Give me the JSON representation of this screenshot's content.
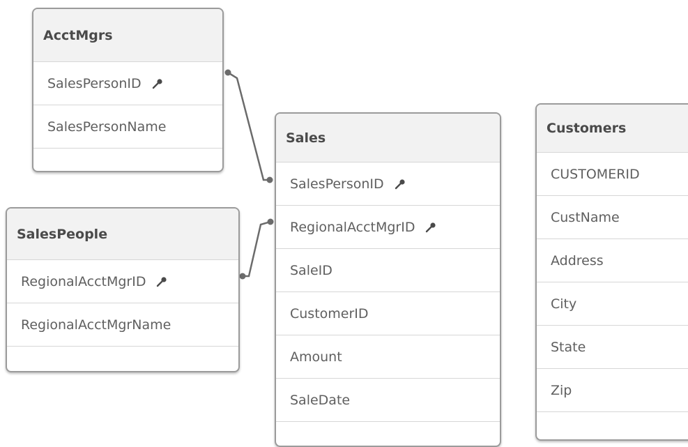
{
  "tables": {
    "acctmgrs": {
      "name": "AcctMgrs",
      "fields": [
        {
          "label": "SalesPersonID",
          "key": true
        },
        {
          "label": "SalesPersonName",
          "key": false
        }
      ]
    },
    "salespeople": {
      "name": "SalesPeople",
      "fields": [
        {
          "label": "RegionalAcctMgrID",
          "key": true
        },
        {
          "label": "RegionalAcctMgrName",
          "key": false
        }
      ]
    },
    "sales": {
      "name": "Sales",
      "fields": [
        {
          "label": "SalesPersonID",
          "key": true
        },
        {
          "label": "RegionalAcctMgrID",
          "key": true
        },
        {
          "label": "SaleID",
          "key": false
        },
        {
          "label": "CustomerID",
          "key": false
        },
        {
          "label": "Amount",
          "key": false
        },
        {
          "label": "SaleDate",
          "key": false
        }
      ]
    },
    "customers": {
      "name": "Customers",
      "fields": [
        {
          "label": "CUSTOMERID",
          "key": false
        },
        {
          "label": "CustName",
          "key": false
        },
        {
          "label": "Address",
          "key": false
        },
        {
          "label": "City",
          "key": false
        },
        {
          "label": "State",
          "key": false
        },
        {
          "label": "Zip",
          "key": false
        }
      ]
    }
  },
  "links": [
    {
      "from": "AcctMgrs.SalesPersonID",
      "to": "Sales.SalesPersonID"
    },
    {
      "from": "SalesPeople.RegionalAcctMgrID",
      "to": "Sales.RegionalAcctMgrID"
    }
  ],
  "colors": {
    "link_line": "#6b6b6b",
    "table_border": "#9b9b9b",
    "header_background": "#f2f2f2"
  },
  "icons": {
    "key_field": "key-icon"
  }
}
